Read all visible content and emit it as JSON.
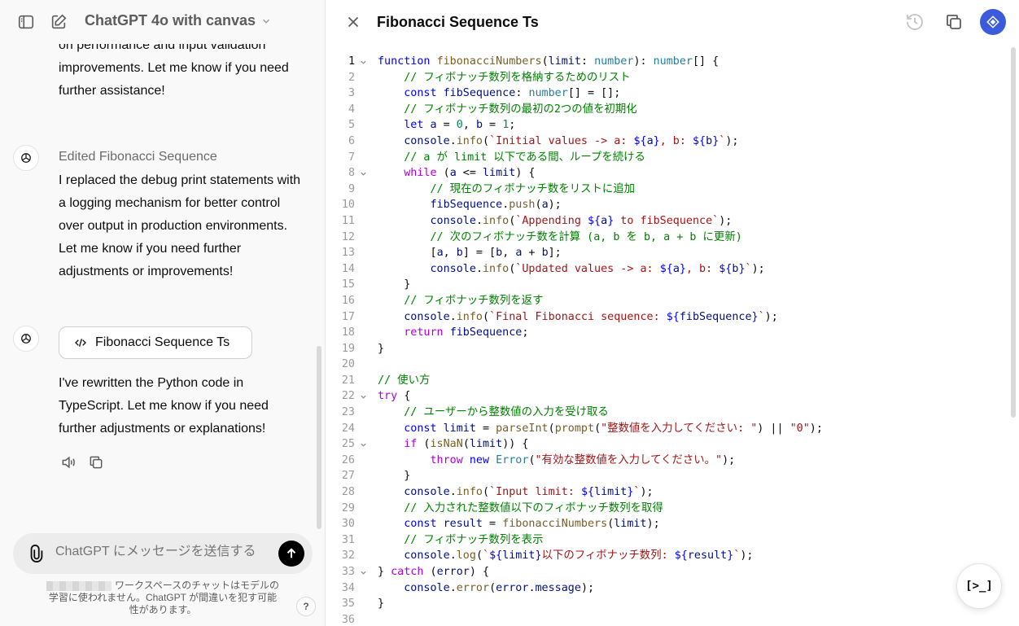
{
  "sidebar": {
    "model_title": "ChatGPT 4o with canvas",
    "messages": [
      {
        "text": "on performance and input validation improvements. Let me know if you need further assistance!"
      },
      {
        "meta": "Edited Fibonacci Sequence",
        "text": "I replaced the debug print statements with a logging mechanism for better control over output in production environments. Let me know if you need further adjustments or improvements!"
      },
      {
        "canvas_label": "Fibonacci Sequence Ts",
        "text": "I've rewritten the Python code in TypeScript. Let me know if you need further adjustments or explanations!"
      }
    ],
    "composer_placeholder": "ChatGPT にメッセージを送信する",
    "disclaimer": "ワークスペースのチャットはモデルの学習に使われません。ChatGPT が間違いを犯す可能性があります。",
    "help": "?"
  },
  "canvas": {
    "title": "Fibonacci Sequence Ts",
    "run_label": "[>_]"
  },
  "code_lines": [
    "function fibonacciNumbers(limit: number): number[] {",
    "    // フィボナッチ数列を格納するためのリスト",
    "    const fibSequence: number[] = [];",
    "    // フィボナッチ数列の最初の2つの値を初期化",
    "    let a = 0, b = 1;",
    "    console.info(`Initial values -> a: ${a}, b: ${b}`);",
    "    // a が limit 以下である間、ループを続ける",
    "    while (a <= limit) {",
    "        // 現在のフィボナッチ数をリストに追加",
    "        fibSequence.push(a);",
    "        console.info(`Appending ${a} to fibSequence`);",
    "        // 次のフィボナッチ数を計算 (a, b を b, a + b に更新)",
    "        [a, b] = [b, a + b];",
    "        console.info(`Updated values -> a: ${a}, b: ${b}`);",
    "    }",
    "    // フィボナッチ数列を返す",
    "    console.info(`Final Fibonacci sequence: ${fibSequence}`);",
    "    return fibSequence;",
    "}",
    "",
    "// 使い方",
    "try {",
    "    // ユーザーから整数値の入力を受け取る",
    "    const limit = parseInt(prompt(\"整数値を入力してください: \") || \"0\");",
    "    if (isNaN(limit)) {",
    "        throw new Error(\"有効な整数値を入力してください。\");",
    "    }",
    "    console.info(`Input limit: ${limit}`);",
    "    // 入力された整数値以下のフィボナッチ数列を取得",
    "    const result = fibonacciNumbers(limit);",
    "    // フィボナッチ数列を表示",
    "    console.log(`${limit}以下のフィボナッチ数列: ${result}`);",
    "} catch (error) {",
    "    console.error(error.message);",
    "}",
    ""
  ],
  "fold_lines": [
    1,
    8,
    22,
    25,
    33
  ],
  "active_line": 1
}
